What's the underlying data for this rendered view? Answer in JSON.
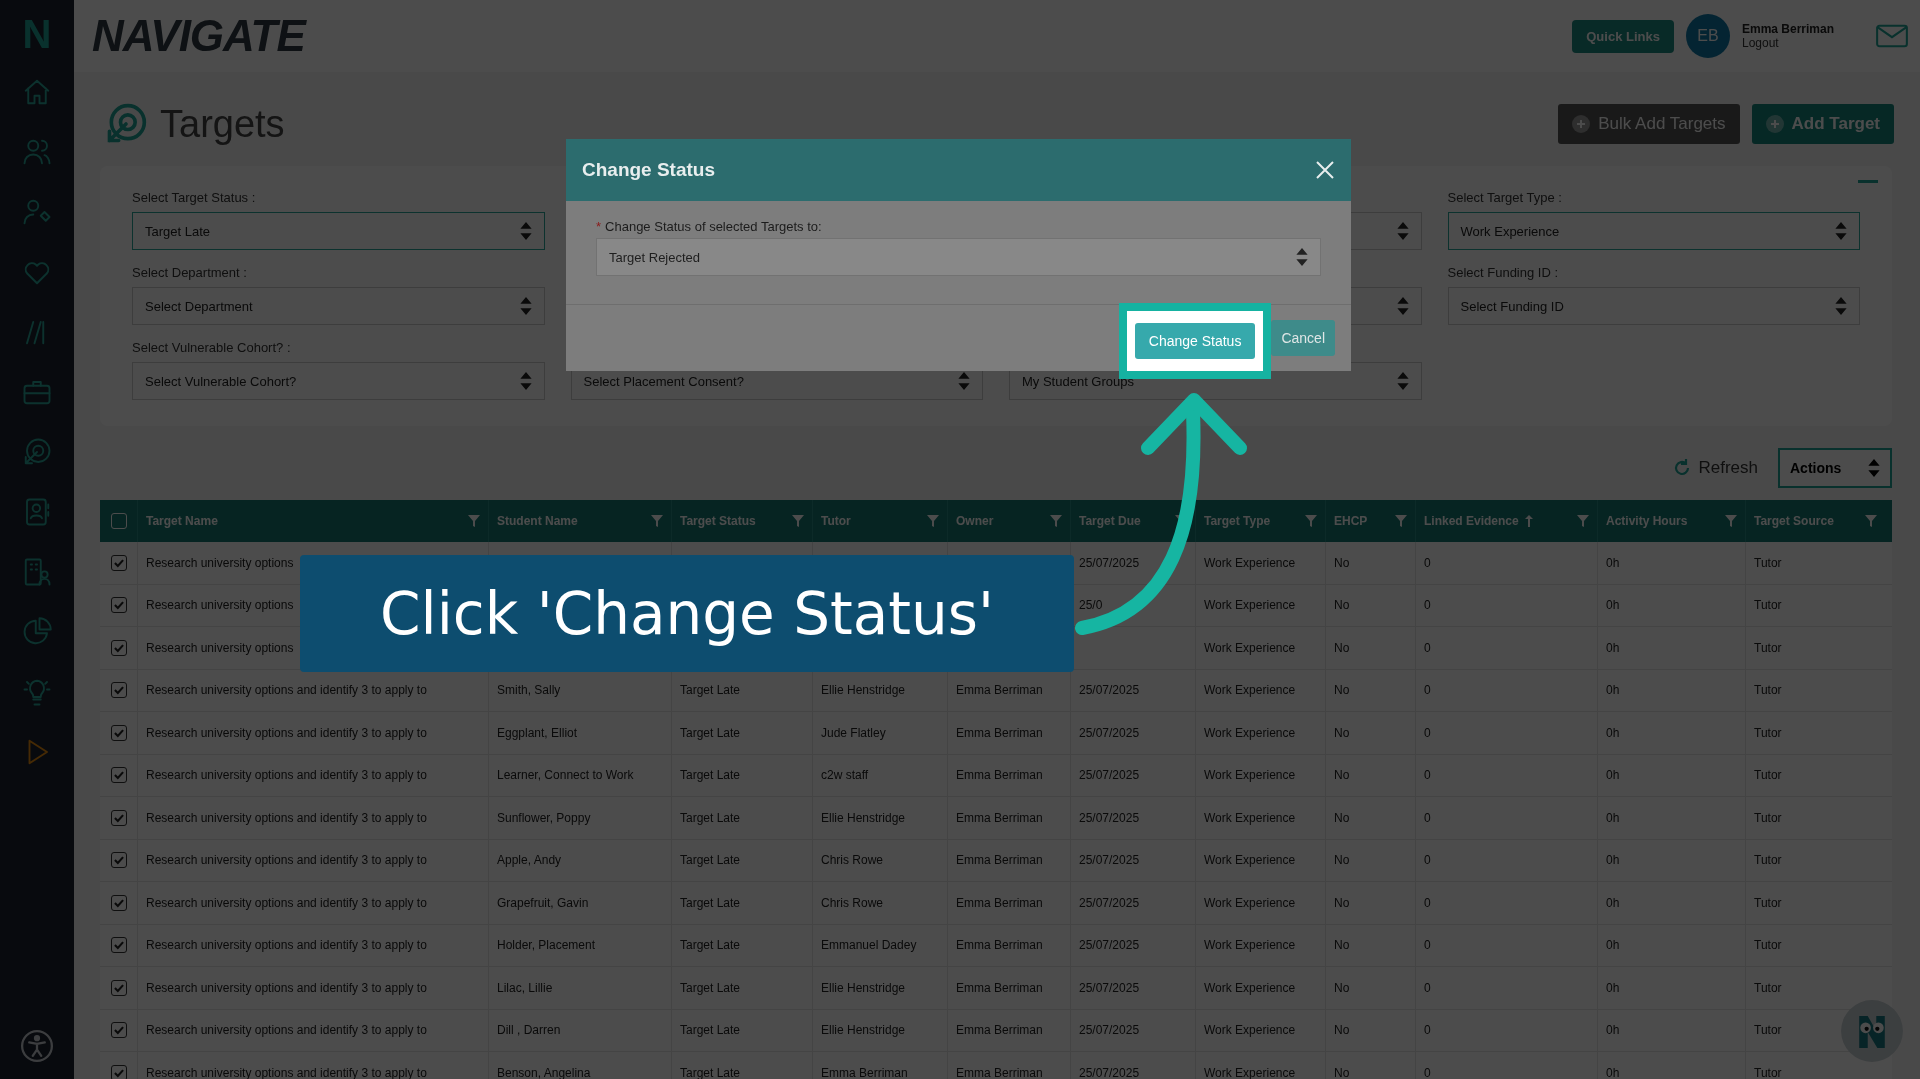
{
  "sidebar": {
    "logo": "N"
  },
  "header": {
    "logo": "NAVIGATE",
    "quick_links": "Quick Links",
    "user": {
      "initials": "EB",
      "name": "Emma Berriman",
      "logout": "Logout"
    }
  },
  "page": {
    "title": "Targets",
    "buttons": [
      "Bulk Add Targets",
      "Add Target"
    ]
  },
  "filter_columns": [
    [
      {
        "kind": "select",
        "label": "Select Target Status :",
        "value": "Target Late"
      },
      {
        "kind": "select",
        "label": "Select Department :",
        "value": "Select Department"
      },
      {
        "kind": "select",
        "label": "Select Vulnerable Cohort? :",
        "value": "Select Vulnerable Cohort?"
      }
    ],
    [
      {
        "kind": "select",
        "value": "Select Placement Consent?"
      }
    ],
    [
      {
        "kind": "select"
      },
      {
        "kind": "select"
      },
      {
        "kind": "select",
        "value": "My Student Groups"
      }
    ],
    [
      {
        "kind": "select",
        "label": "Select Target Type :",
        "value": "Work Experience"
      },
      {
        "kind": "select",
        "label": "Select Funding ID :",
        "value": "Select Funding ID"
      }
    ]
  ],
  "toolbar": {
    "refresh": "Refresh",
    "actions": "Actions"
  },
  "table": {
    "select_all_checked": false,
    "columns": [
      {
        "label": "Target Name",
        "sorted": false
      },
      {
        "label": "Student Name",
        "sorted": false
      },
      {
        "label": "Target Status",
        "sorted": false
      },
      {
        "label": "Tutor",
        "sorted": false
      },
      {
        "label": "Owner",
        "sorted": false
      },
      {
        "label": "Target Due",
        "sorted": false
      },
      {
        "label": "Target Type",
        "sorted": false
      },
      {
        "label": "EHCP",
        "sorted": false
      },
      {
        "label": "Linked Evidence",
        "sorted": true
      },
      {
        "label": "Activity Hours",
        "sorted": false
      },
      {
        "label": "Target Source",
        "sorted": false
      }
    ],
    "rows": [
      {
        "kind": "covered",
        "checked": true,
        "target_name": "Research university options",
        "target_due": "25/07/2025",
        "tail": [
          "Work Experience",
          "No",
          "0",
          "0h",
          "Tutor"
        ]
      },
      {
        "kind": "covered",
        "checked": true,
        "target_name": "Research university options",
        "target_due": "25/0",
        "tail": [
          "Work Experience",
          "No",
          "0",
          "0h",
          "Tutor"
        ]
      },
      {
        "kind": "covered",
        "checked": true,
        "target_name": "Research university options",
        "tail": [
          "Work Experience",
          "No",
          "0",
          "0h",
          "Tutor"
        ]
      },
      {
        "kind": "full",
        "checked": true,
        "cells": [
          "Research university options and identify 3 to apply to",
          "Smith, Sally",
          "Target Late",
          "Ellie Henstridge",
          "Emma Berriman",
          "25/07/2025",
          "Work Experience",
          "No",
          "0",
          "0h",
          "Tutor"
        ]
      },
      {
        "kind": "full",
        "checked": true,
        "cells": [
          "Research university options and identify 3 to apply to",
          "Eggplant, Elliot",
          "Target Late",
          "Jude Flatley",
          "Emma Berriman",
          "25/07/2025",
          "Work Experience",
          "No",
          "0",
          "0h",
          "Tutor"
        ]
      },
      {
        "kind": "full",
        "checked": true,
        "cells": [
          "Research university options and identify 3 to apply to",
          "Learner, Connect to Work",
          "Target Late",
          "c2w staff",
          "Emma Berriman",
          "25/07/2025",
          "Work Experience",
          "No",
          "0",
          "0h",
          "Tutor"
        ]
      },
      {
        "kind": "full",
        "checked": true,
        "cells": [
          "Research university options and identify 3 to apply to",
          "Sunflower, Poppy",
          "Target Late",
          "Ellie Henstridge",
          "Emma Berriman",
          "25/07/2025",
          "Work Experience",
          "No",
          "0",
          "0h",
          "Tutor"
        ]
      },
      {
        "kind": "full",
        "checked": true,
        "cells": [
          "Research university options and identify 3 to apply to",
          "Apple, Andy",
          "Target Late",
          "Chris Rowe",
          "Emma Berriman",
          "25/07/2025",
          "Work Experience",
          "No",
          "0",
          "0h",
          "Tutor"
        ]
      },
      {
        "kind": "full",
        "checked": true,
        "cells": [
          "Research university options and identify 3 to apply to",
          "Grapefruit, Gavin",
          "Target Late",
          "Chris Rowe",
          "Emma Berriman",
          "25/07/2025",
          "Work Experience",
          "No",
          "0",
          "0h",
          "Tutor"
        ]
      },
      {
        "kind": "full",
        "checked": true,
        "cells": [
          "Research university options and identify 3 to apply to",
          "Holder, Placement",
          "Target Late",
          "Emmanuel Dadey",
          "Emma Berriman",
          "25/07/2025",
          "Work Experience",
          "No",
          "0",
          "0h",
          "Tutor"
        ]
      },
      {
        "kind": "full",
        "checked": true,
        "cells": [
          "Research university options and identify 3 to apply to",
          "Lilac, Lillie",
          "Target Late",
          "Ellie Henstridge",
          "Emma Berriman",
          "25/07/2025",
          "Work Experience",
          "No",
          "0",
          "0h",
          "Tutor"
        ]
      },
      {
        "kind": "full",
        "checked": true,
        "cells": [
          "Research university options and identify 3 to apply to",
          "Dill , Darren",
          "Target Late",
          "Ellie Henstridge",
          "Emma Berriman",
          "25/07/2025",
          "Work Experience",
          "No",
          "0",
          "0h",
          "Tutor"
        ]
      },
      {
        "kind": "full",
        "checked": true,
        "cells": [
          "Research university options and identify 3 to apply to",
          "Benson, Angelina",
          "Target Late",
          "Emma Berriman",
          "Emma Berriman",
          "25/07/2025",
          "Work Experience",
          "No",
          "0",
          "0h",
          "Tutor"
        ]
      }
    ]
  },
  "modal": {
    "title": "Change Status",
    "field": {
      "required": true,
      "required_mark": "*",
      "label": "Change Status of selected Targets to:",
      "value": "Target Rejected"
    },
    "primary": "Change Status",
    "secondary": "Cancel"
  },
  "callout": {
    "text": "Click 'Change Status'"
  }
}
